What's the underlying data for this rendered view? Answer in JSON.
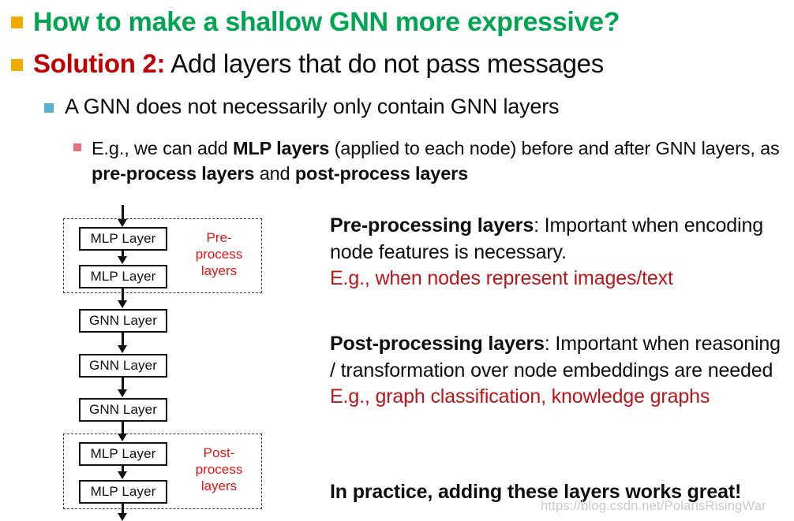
{
  "slide": {
    "bullets": {
      "title": "How to make a shallow GNN more expressive?",
      "solution_lead": "Solution 2:",
      "solution_rest": " Add layers that do not pass messages",
      "level2": "A GNN does not necessarily only contain GNN layers",
      "level3": {
        "p1": "E.g., we can add ",
        "b1": "MLP layers",
        "p2": " (applied to each node) before and after GNN layers, as ",
        "b2": "pre-process layers",
        "p3": " and ",
        "b3": "post-process layers"
      }
    },
    "diagram": {
      "nodes": [
        {
          "label": "MLP Layer"
        },
        {
          "label": "MLP Layer"
        },
        {
          "label": "GNN Layer"
        },
        {
          "label": "GNN Layer"
        },
        {
          "label": "GNN Layer"
        },
        {
          "label": "MLP Layer"
        },
        {
          "label": "MLP Layer"
        }
      ],
      "pre_group_label": "Pre-\nprocess\nlayers",
      "post_group_label": "Post-\nprocess\nlayers"
    },
    "right_column": {
      "pre": {
        "heading": "Pre-processing layers",
        "body": ": Important when encoding node features is necessary.",
        "example": "E.g., when nodes represent images/text"
      },
      "post": {
        "heading": "Post-processing layers",
        "body": ": Important when reasoning / transformation over node embeddings are needed",
        "example": "E.g., graph classification, knowledge graphs"
      },
      "final": "In practice, adding these layers works great!"
    },
    "watermark": "https://blog.csdn.net/PolarisRisingWar",
    "colors": {
      "title_green": "#00A551",
      "solution_red": "#C00000",
      "example_red": "#C01418",
      "group_label_red": "#EE1111",
      "bullet_l1": "#F0AB00",
      "bullet_l2": "#5BAFCF",
      "bullet_l3": "#E8707E"
    }
  }
}
